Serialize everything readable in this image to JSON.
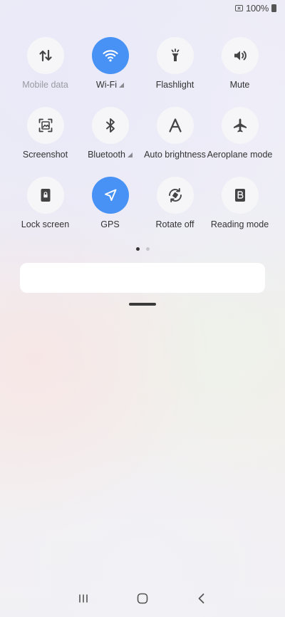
{
  "status_bar": {
    "battery_text": "100%"
  },
  "tiles": [
    {
      "label": "Mobile data",
      "icon": "mobile-data-icon",
      "active": false,
      "disabled": true,
      "signal": false
    },
    {
      "label": "Wi-Fi",
      "icon": "wifi-icon",
      "active": true,
      "disabled": false,
      "signal": true
    },
    {
      "label": "Flashlight",
      "icon": "flashlight-icon",
      "active": false,
      "disabled": false,
      "signal": false
    },
    {
      "label": "Mute",
      "icon": "sound-icon",
      "active": false,
      "disabled": false,
      "signal": false
    },
    {
      "label": "Screenshot",
      "icon": "screenshot-icon",
      "active": false,
      "disabled": false,
      "signal": false
    },
    {
      "label": "Bluetooth",
      "icon": "bluetooth-icon",
      "active": false,
      "disabled": false,
      "signal": true
    },
    {
      "label": "Auto brightness",
      "icon": "auto-brightness-icon",
      "active": false,
      "disabled": false,
      "signal": false
    },
    {
      "label": "Aeroplane mode",
      "icon": "airplane-icon",
      "active": false,
      "disabled": false,
      "signal": false
    },
    {
      "label": "Lock screen",
      "icon": "lock-screen-icon",
      "active": false,
      "disabled": false,
      "signal": false
    },
    {
      "label": "GPS",
      "icon": "location-icon",
      "active": true,
      "disabled": false,
      "signal": false
    },
    {
      "label": "Rotate off",
      "icon": "rotate-icon",
      "active": false,
      "disabled": false,
      "signal": false
    },
    {
      "label": "Reading mode",
      "icon": "reading-mode-icon",
      "active": false,
      "disabled": false,
      "signal": false
    }
  ],
  "page_indicator": {
    "current": 1,
    "total": 2
  },
  "colors": {
    "active_tile": "#4892f5",
    "inactive_tile": "#f6f6f9",
    "icon_dark": "#444444",
    "icon_light": "#ffffff"
  },
  "nav_bar": {
    "recent_icon": "recent-apps-icon",
    "home_icon": "home-icon",
    "back_icon": "back-icon"
  }
}
